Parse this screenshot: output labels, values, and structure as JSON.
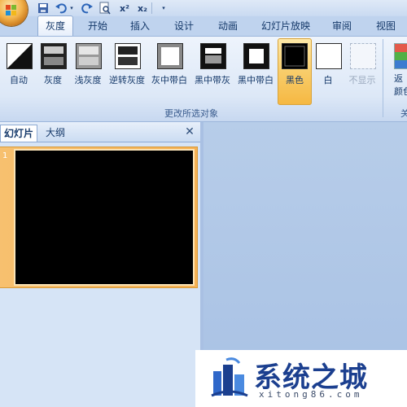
{
  "quick_access": {
    "superscript_label": "x²",
    "subscript_label": "x₂"
  },
  "tabs": [
    {
      "label": "灰度",
      "active": true
    },
    {
      "label": "开始"
    },
    {
      "label": "插入"
    },
    {
      "label": "设计"
    },
    {
      "label": "动画"
    },
    {
      "label": "幻灯片放映"
    },
    {
      "label": "审阅"
    },
    {
      "label": "视图"
    }
  ],
  "ribbon": {
    "group_label": "更改所选对象",
    "commands": [
      {
        "label": "自动",
        "icon": "auto-grayscale-icon"
      },
      {
        "label": "灰度",
        "icon": "grayscale-icon"
      },
      {
        "label": "浅灰度",
        "icon": "light-grayscale-icon"
      },
      {
        "label": "逆转灰度",
        "icon": "inverse-grayscale-icon"
      },
      {
        "label": "灰中带白",
        "icon": "gray-with-white-fill-icon"
      },
      {
        "label": "黑中带灰",
        "icon": "black-with-grayscale-fill-icon"
      },
      {
        "label": "黑中带白",
        "icon": "black-with-white-fill-icon"
      },
      {
        "label": "黑色",
        "icon": "black-icon",
        "selected": true
      },
      {
        "label": "白",
        "icon": "white-icon"
      },
      {
        "label": "不显示",
        "icon": "dont-show-icon",
        "disabled": true
      }
    ],
    "right_command_label": "返\n颜色",
    "right_group_label": "关"
  },
  "slide_pane": {
    "tabs": [
      {
        "label": "幻灯片",
        "active": true
      },
      {
        "label": "大纲"
      }
    ],
    "close_symbol": "✕",
    "slide_number": "1"
  },
  "watermark": {
    "text": "系统之城",
    "domain": "xitong86.com"
  },
  "colors": {
    "accent_selected": "#f8cd6b",
    "ribbon_bg": "#dde8f7",
    "text": "#15396a"
  }
}
